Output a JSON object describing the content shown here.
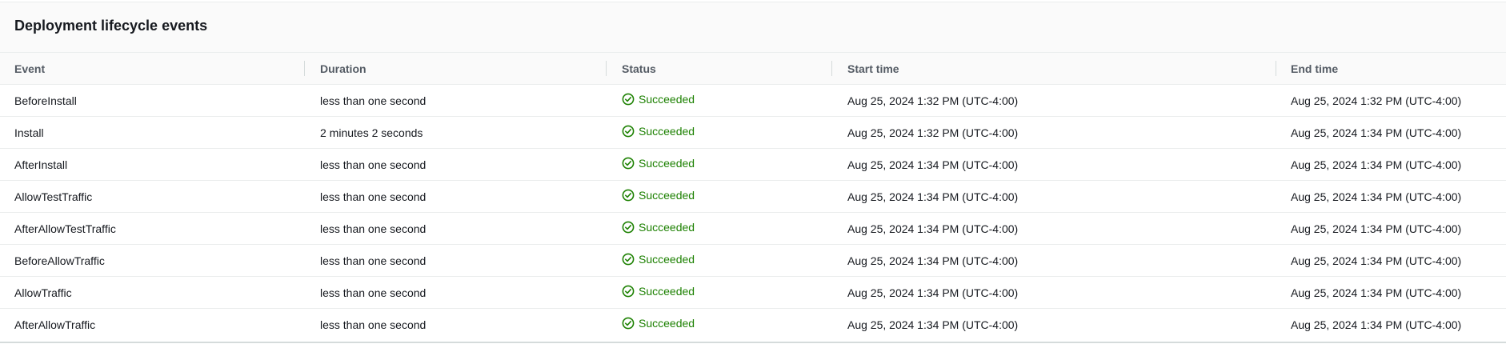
{
  "panel": {
    "title": "Deployment lifecycle events"
  },
  "table": {
    "columns": [
      "Event",
      "Duration",
      "Status",
      "Start time",
      "End time"
    ],
    "rows": [
      {
        "event": "BeforeInstall",
        "duration": "less than one second",
        "status": "Succeeded",
        "start": "Aug 25, 2024 1:32 PM (UTC-4:00)",
        "end": "Aug 25, 2024 1:32 PM (UTC-4:00)"
      },
      {
        "event": "Install",
        "duration": "2 minutes 2 seconds",
        "status": "Succeeded",
        "start": "Aug 25, 2024 1:32 PM (UTC-4:00)",
        "end": "Aug 25, 2024 1:34 PM (UTC-4:00)"
      },
      {
        "event": "AfterInstall",
        "duration": "less than one second",
        "status": "Succeeded",
        "start": "Aug 25, 2024 1:34 PM (UTC-4:00)",
        "end": "Aug 25, 2024 1:34 PM (UTC-4:00)"
      },
      {
        "event": "AllowTestTraffic",
        "duration": "less than one second",
        "status": "Succeeded",
        "start": "Aug 25, 2024 1:34 PM (UTC-4:00)",
        "end": "Aug 25, 2024 1:34 PM (UTC-4:00)"
      },
      {
        "event": "AfterAllowTestTraffic",
        "duration": "less than one second",
        "status": "Succeeded",
        "start": "Aug 25, 2024 1:34 PM (UTC-4:00)",
        "end": "Aug 25, 2024 1:34 PM (UTC-4:00)"
      },
      {
        "event": "BeforeAllowTraffic",
        "duration": "less than one second",
        "status": "Succeeded",
        "start": "Aug 25, 2024 1:34 PM (UTC-4:00)",
        "end": "Aug 25, 2024 1:34 PM (UTC-4:00)"
      },
      {
        "event": "AllowTraffic",
        "duration": "less than one second",
        "status": "Succeeded",
        "start": "Aug 25, 2024 1:34 PM (UTC-4:00)",
        "end": "Aug 25, 2024 1:34 PM (UTC-4:00)"
      },
      {
        "event": "AfterAllowTraffic",
        "duration": "less than one second",
        "status": "Succeeded",
        "start": "Aug 25, 2024 1:34 PM (UTC-4:00)",
        "end": "Aug 25, 2024 1:34 PM (UTC-4:00)"
      }
    ]
  },
  "icons": {
    "status": "check-circle-icon"
  },
  "colors": {
    "success": "#1d8102",
    "header_text": "#545b64",
    "text": "#16191f"
  }
}
